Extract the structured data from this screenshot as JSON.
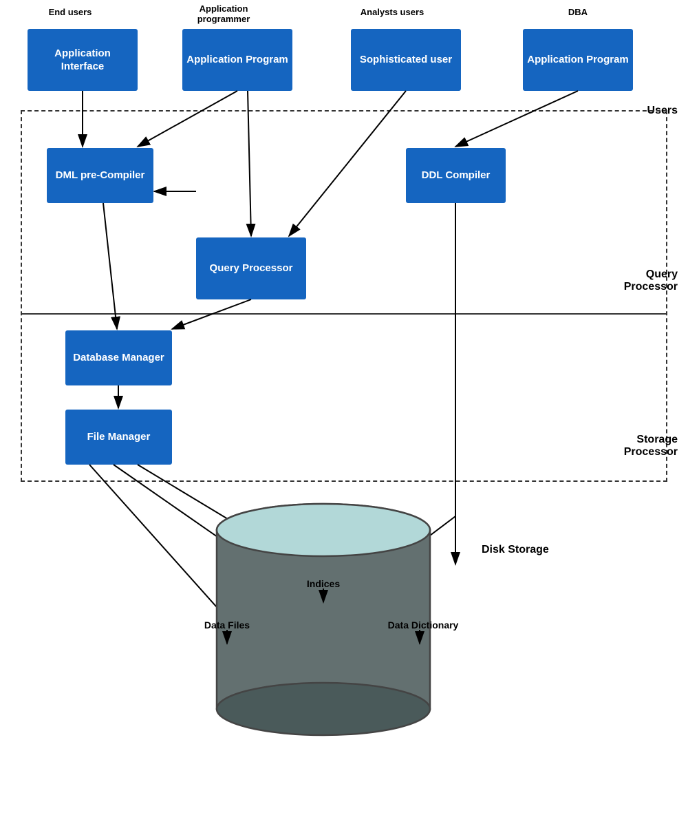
{
  "labels": {
    "end_users": "End users",
    "app_programmer": "Application\nprogrammer",
    "analysts_users": "Analysts users",
    "dba": "DBA",
    "users_section": "Users",
    "query_processor_section": "Query\nProcessor",
    "storage_processor_section": "Storage\nProcessor",
    "disk_storage": "Disk Storage"
  },
  "boxes": {
    "app_interface": "Application\nInterface",
    "app_program_left": "Application\nProgram",
    "sophisticated_user": "Sophisticated\nuser",
    "app_program_right": "Application\nProgram",
    "dml_precompiler": "DML\npre-Compiler",
    "ddl_compiler": "DDL\nCompiler",
    "query_processor": "Query\nProcessor",
    "database_manager": "Database\nManager",
    "file_manager": "File\nManager"
  },
  "storage_labels": {
    "indices": "Indices",
    "data_files": "Data\nFiles",
    "data_dictionary": "Data\nDictionary"
  }
}
